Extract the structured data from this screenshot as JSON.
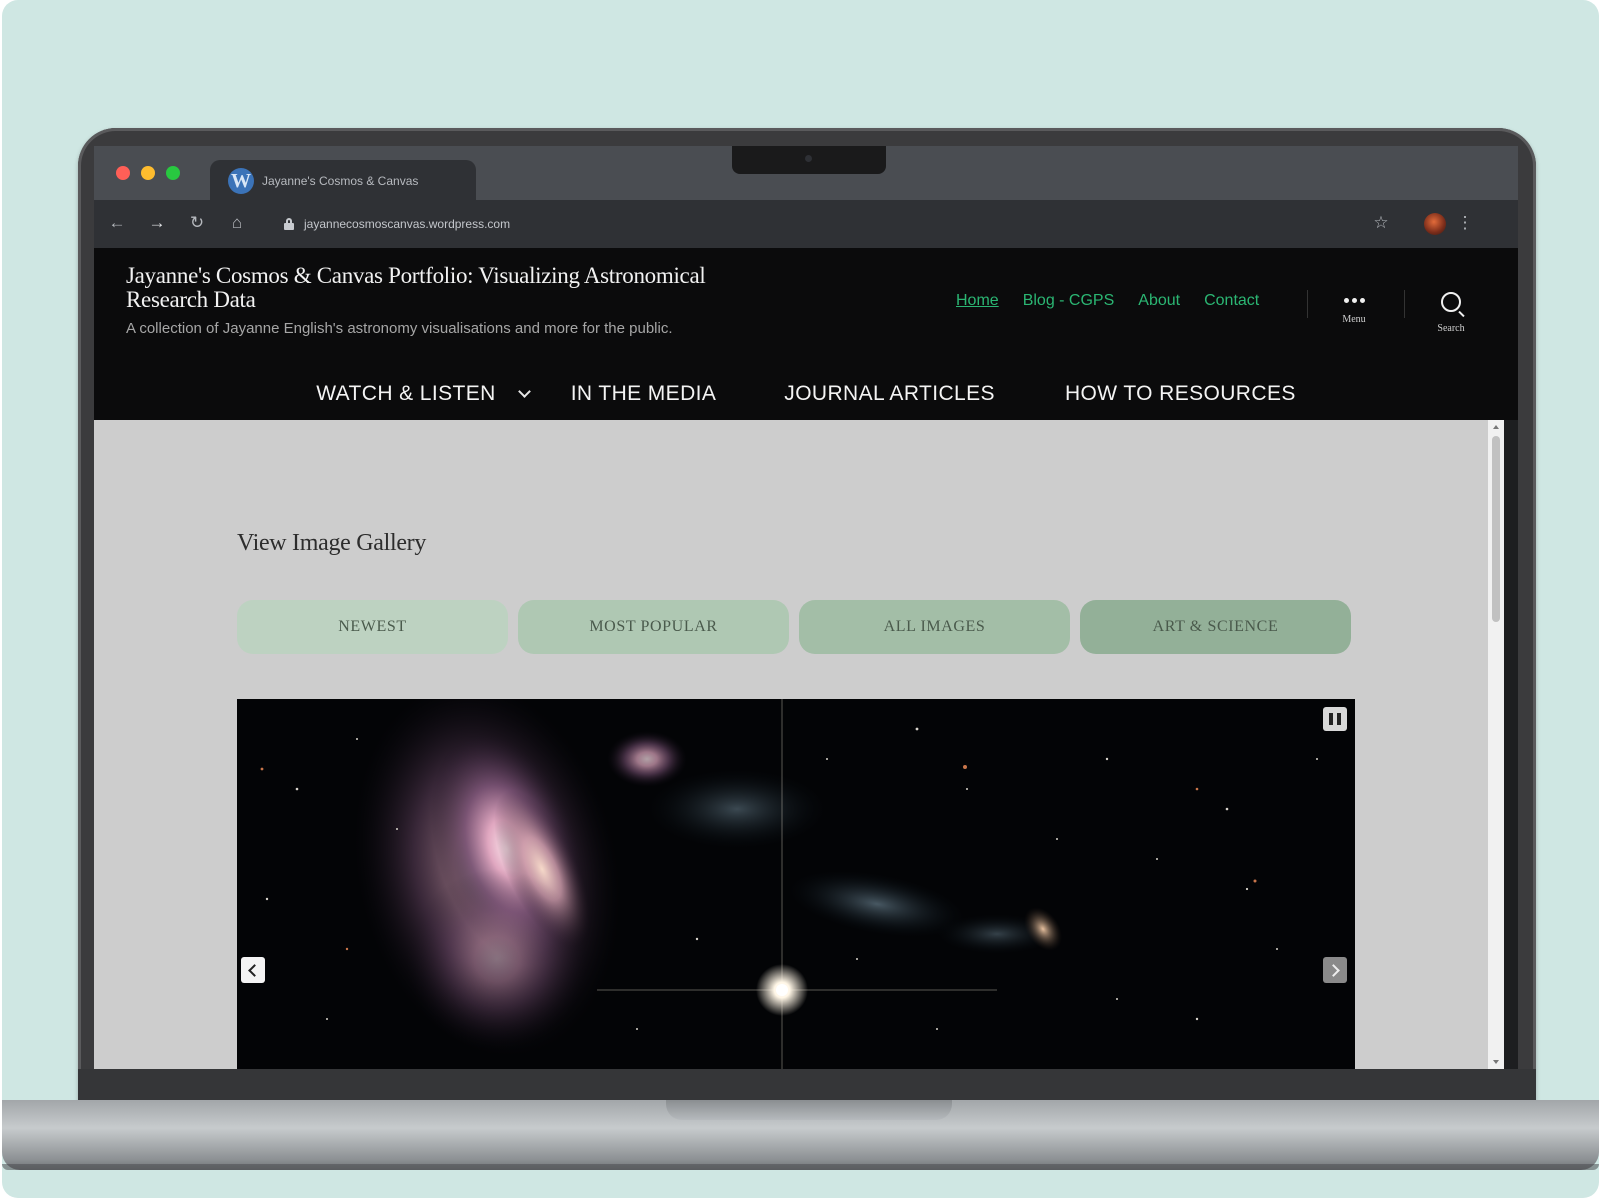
{
  "browser": {
    "tab_title": "Jayanne's Cosmos & Canvas",
    "url": "jayannecosmoscanvas.wordpress.com",
    "icons": [
      "back-arrow-icon",
      "forward-arrow-icon",
      "reload-icon",
      "home-icon",
      "lock-icon",
      "star-icon",
      "kebab-menu-icon"
    ]
  },
  "site": {
    "title": "Jayanne's Cosmos & Canvas Portfolio: Visualizing Astronomical Research Data",
    "description": "A collection of Jayanne English's astronomy visualisations and more for the public.",
    "top_nav": [
      {
        "label": "Home",
        "active": true
      },
      {
        "label": "Blog - CGPS",
        "active": false
      },
      {
        "label": "About",
        "active": false
      },
      {
        "label": "Contact",
        "active": false
      }
    ],
    "menu_label": "Menu",
    "search_label": "Search",
    "main_nav": [
      {
        "label": "WATCH & LISTEN",
        "has_dropdown": true
      },
      {
        "label": "IN THE MEDIA",
        "has_dropdown": false
      },
      {
        "label": "JOURNAL ARTICLES",
        "has_dropdown": false
      },
      {
        "label": "HOW TO RESOURCES",
        "has_dropdown": false
      }
    ]
  },
  "gallery": {
    "title": "View Image Gallery",
    "filters": [
      "NEWEST",
      "MOST POPULAR",
      "ALL IMAGES",
      "ART & SCIENCE"
    ]
  },
  "colors": {
    "link_green": "#2bb673",
    "header_bg": "#0b0b0c",
    "content_bg": "#cdcdcd",
    "page_bg": "#cfe7e3"
  }
}
